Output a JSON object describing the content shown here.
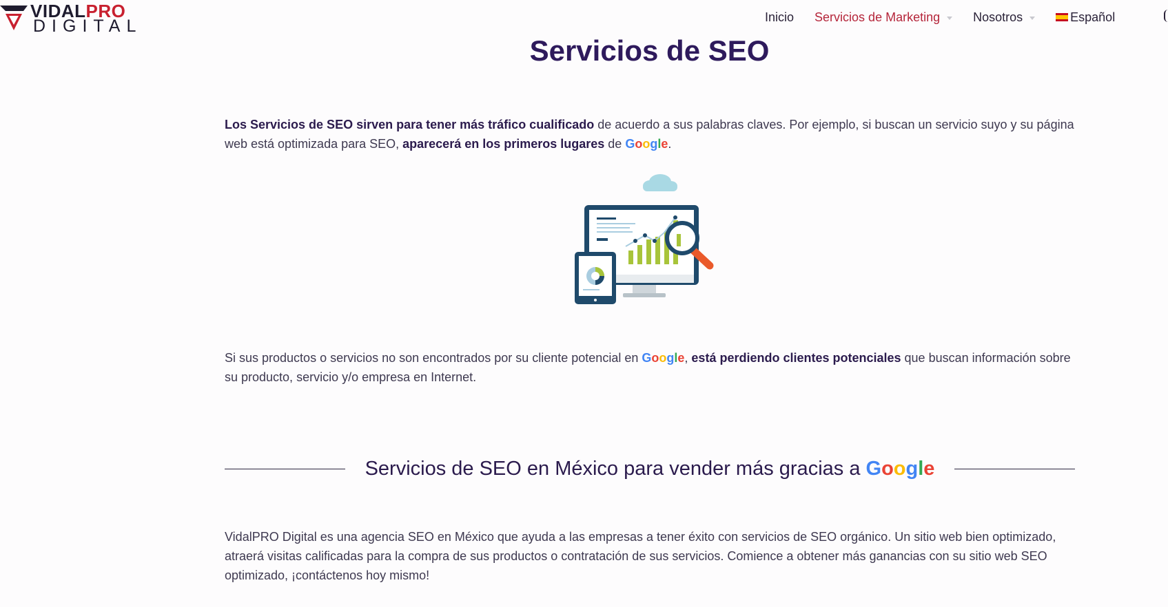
{
  "header": {
    "logo_part1": "VIDAL",
    "logo_part2": "PRO",
    "logo_line2": "DIGITAL",
    "nav": {
      "inicio": "Inicio",
      "servicios": "Servicios de Marketing",
      "nosotros": "Nosotros",
      "idioma": "Español"
    }
  },
  "main": {
    "title": "Servicios de SEO",
    "p1": {
      "bold1": "Los Servicios de SEO sirven para tener más tráfico cualificado",
      "text1": " de acuerdo a sus palabras claves. Por ejemplo, si buscan un servicio suyo y su página web está optimizada para SEO, ",
      "bold2": "aparecerá en los primeros lugares",
      "text2": " de ",
      "end": "."
    },
    "p2": {
      "text1": "Si sus productos o servicios no son encontrados por su cliente potencial en ",
      "sep": ", ",
      "bold1": "está perdiendo clientes potenciales",
      "text2": " que buscan información sobre su producto, servicio y/o empresa en Internet."
    },
    "section_heading": "Servicios de SEO en México para vender más gracias a ",
    "p3": "VidalPRO Digital es una agencia SEO en México que ayuda a las empresas a tener éxito con servicios de SEO orgánico. Un sitio web bien optimizado, atraerá visitas calificadas para la compra de sus productos o contratación de sus servicios. Comience a obtener más ganancias con su sitio web SEO optimizado, ¡contáctenos hoy mismo!"
  },
  "google": {
    "G": "G",
    "o1": "o",
    "o2": "o",
    "g": "g",
    "l": "l",
    "e": "e"
  },
  "colors": {
    "brand_red": "#c8202f",
    "title_purple": "#2e1a5c",
    "google_blue": "#4285F4",
    "google_red": "#EA4335",
    "google_yellow": "#FBBC05",
    "google_green": "#34A853"
  },
  "icons": [
    "vidalpro-logo-icon",
    "dropdown-caret-icon",
    "spain-flag-icon",
    "seo-analytics-illustration"
  ]
}
